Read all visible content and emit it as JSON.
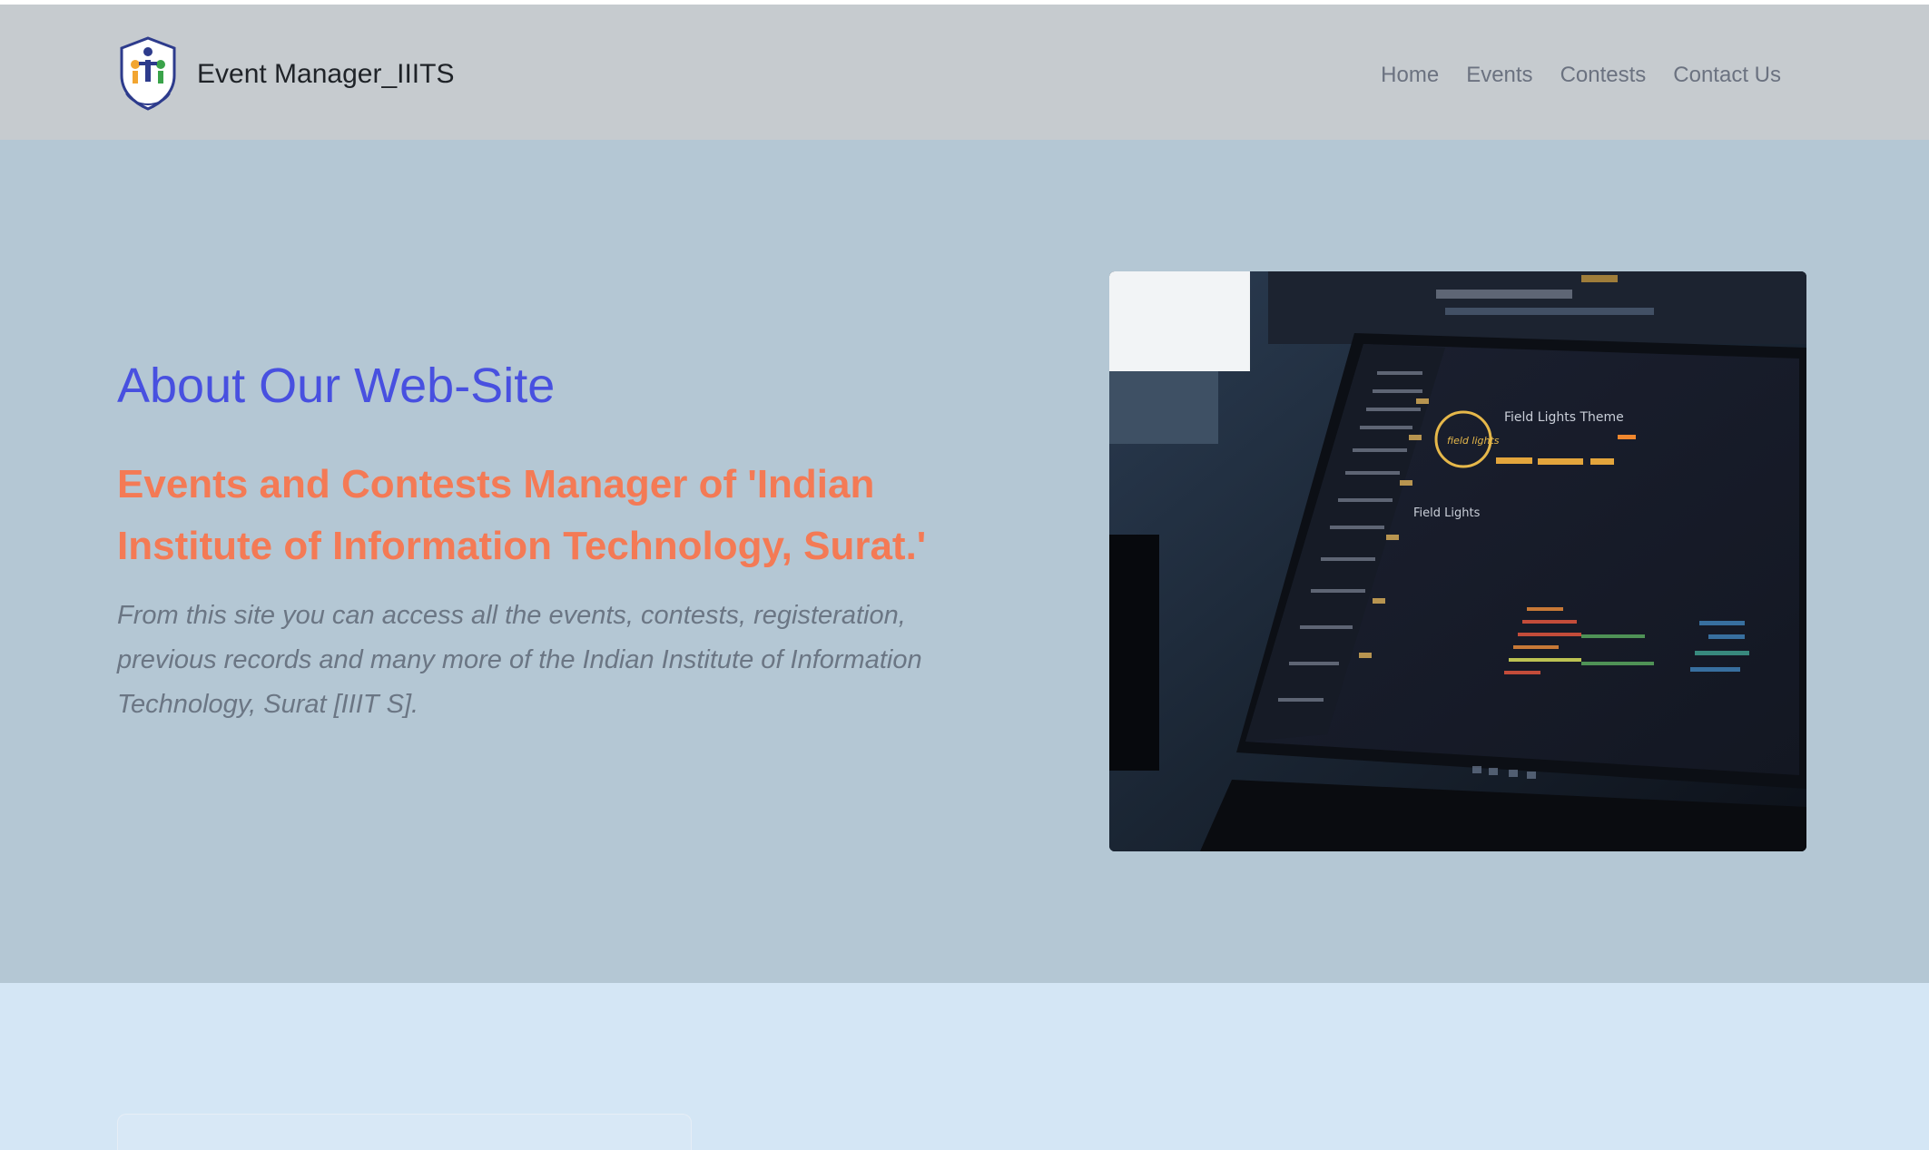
{
  "navbar": {
    "brand": "Event Manager_IIITS",
    "logo": "iiit-surat-shield-logo",
    "links": [
      "Home",
      "Events",
      "Contests",
      "Contact Us"
    ]
  },
  "hero": {
    "title": "About Our Web-Site",
    "subtitle": "Events and Contests Manager of 'Indian Institute of Information Technology, Surat.'",
    "description": "From this site you can access all the events, contests, registeration, previous records and many more of the Indian Institute of Information Technology, Surat [IIIT S].",
    "image": {
      "alt": "laptop-with-code-editor",
      "screen_title": "Field Lights Theme",
      "screen_badge": "field lights",
      "screen_heading": "Field Lights"
    }
  },
  "colors": {
    "navbar_bg": "#c6cbcf",
    "hero_bg": "#b4c7d4",
    "title": "#4850e0",
    "subtitle": "#f47a55",
    "description": "#6b7684",
    "lower_bg": "#d4e6f5"
  }
}
